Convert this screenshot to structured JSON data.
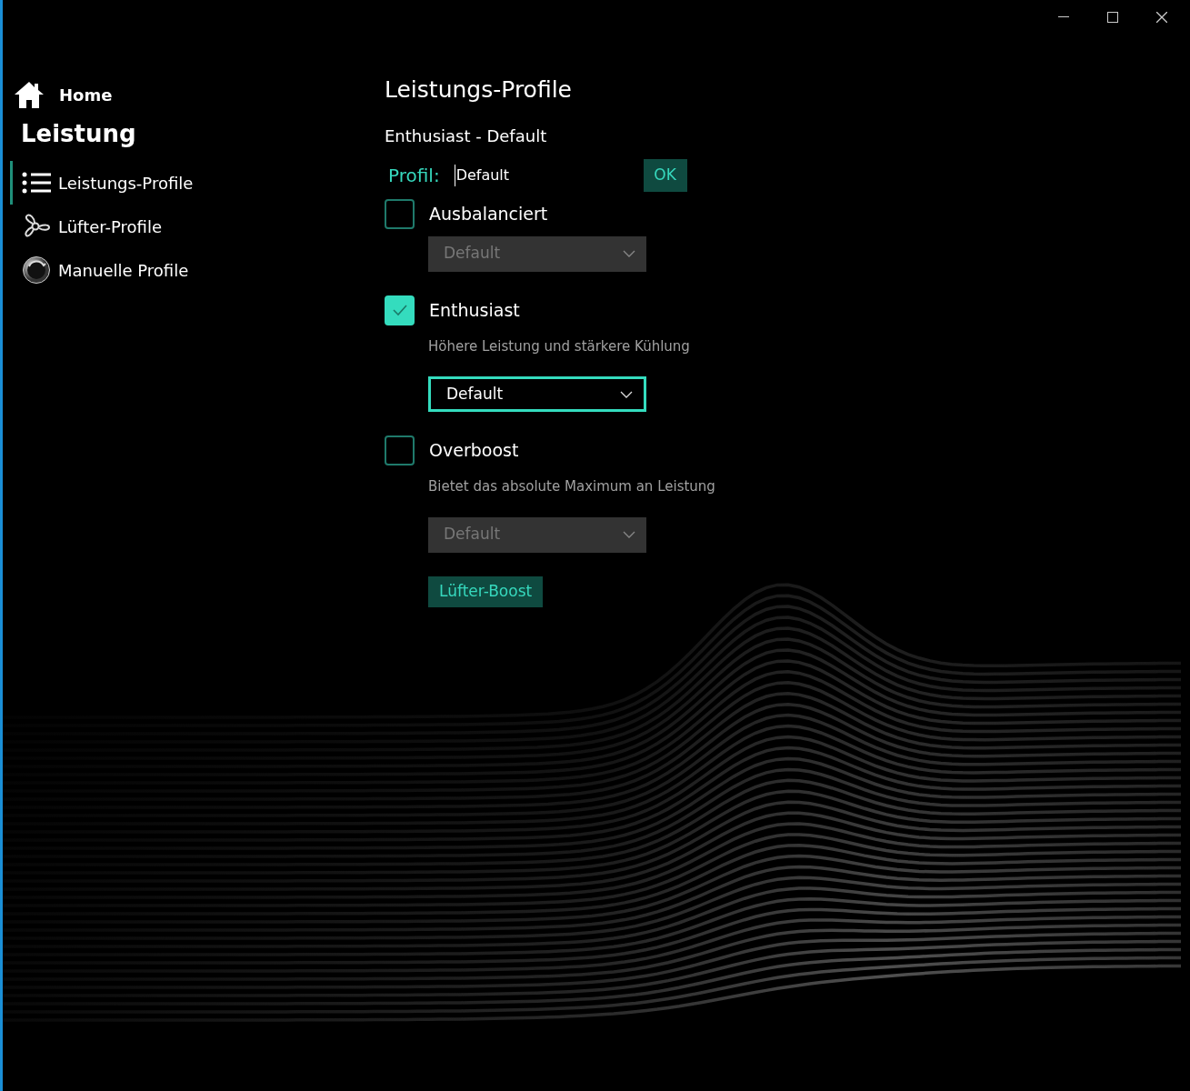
{
  "sidebar": {
    "home": "Home",
    "section": "Leistung",
    "items": [
      {
        "label": "Leistungs-Profile",
        "selected": true
      },
      {
        "label": "Lüfter-Profile",
        "selected": false
      },
      {
        "label": "Manuelle Profile",
        "selected": false
      }
    ]
  },
  "page": {
    "title": "Leistungs-Profile",
    "subtitle": "Enthusiast - Default",
    "profile_label": "Profil:",
    "profile_value": "Default",
    "ok": "OK",
    "profiles": [
      {
        "label": "Ausbalanciert",
        "checked": false,
        "dropdown": {
          "value": "Default",
          "disabled": true
        }
      },
      {
        "label": "Enthusiast",
        "checked": true,
        "description": "Höhere Leistung und stärkere Kühlung",
        "dropdown": {
          "value": "Default",
          "disabled": false
        }
      },
      {
        "label": "Overboost",
        "checked": false,
        "description": "Bietet das absolute Maximum an Leistung",
        "dropdown": {
          "value": "Default",
          "disabled": true
        }
      }
    ],
    "fan_boost": "Lüfter-Boost"
  }
}
